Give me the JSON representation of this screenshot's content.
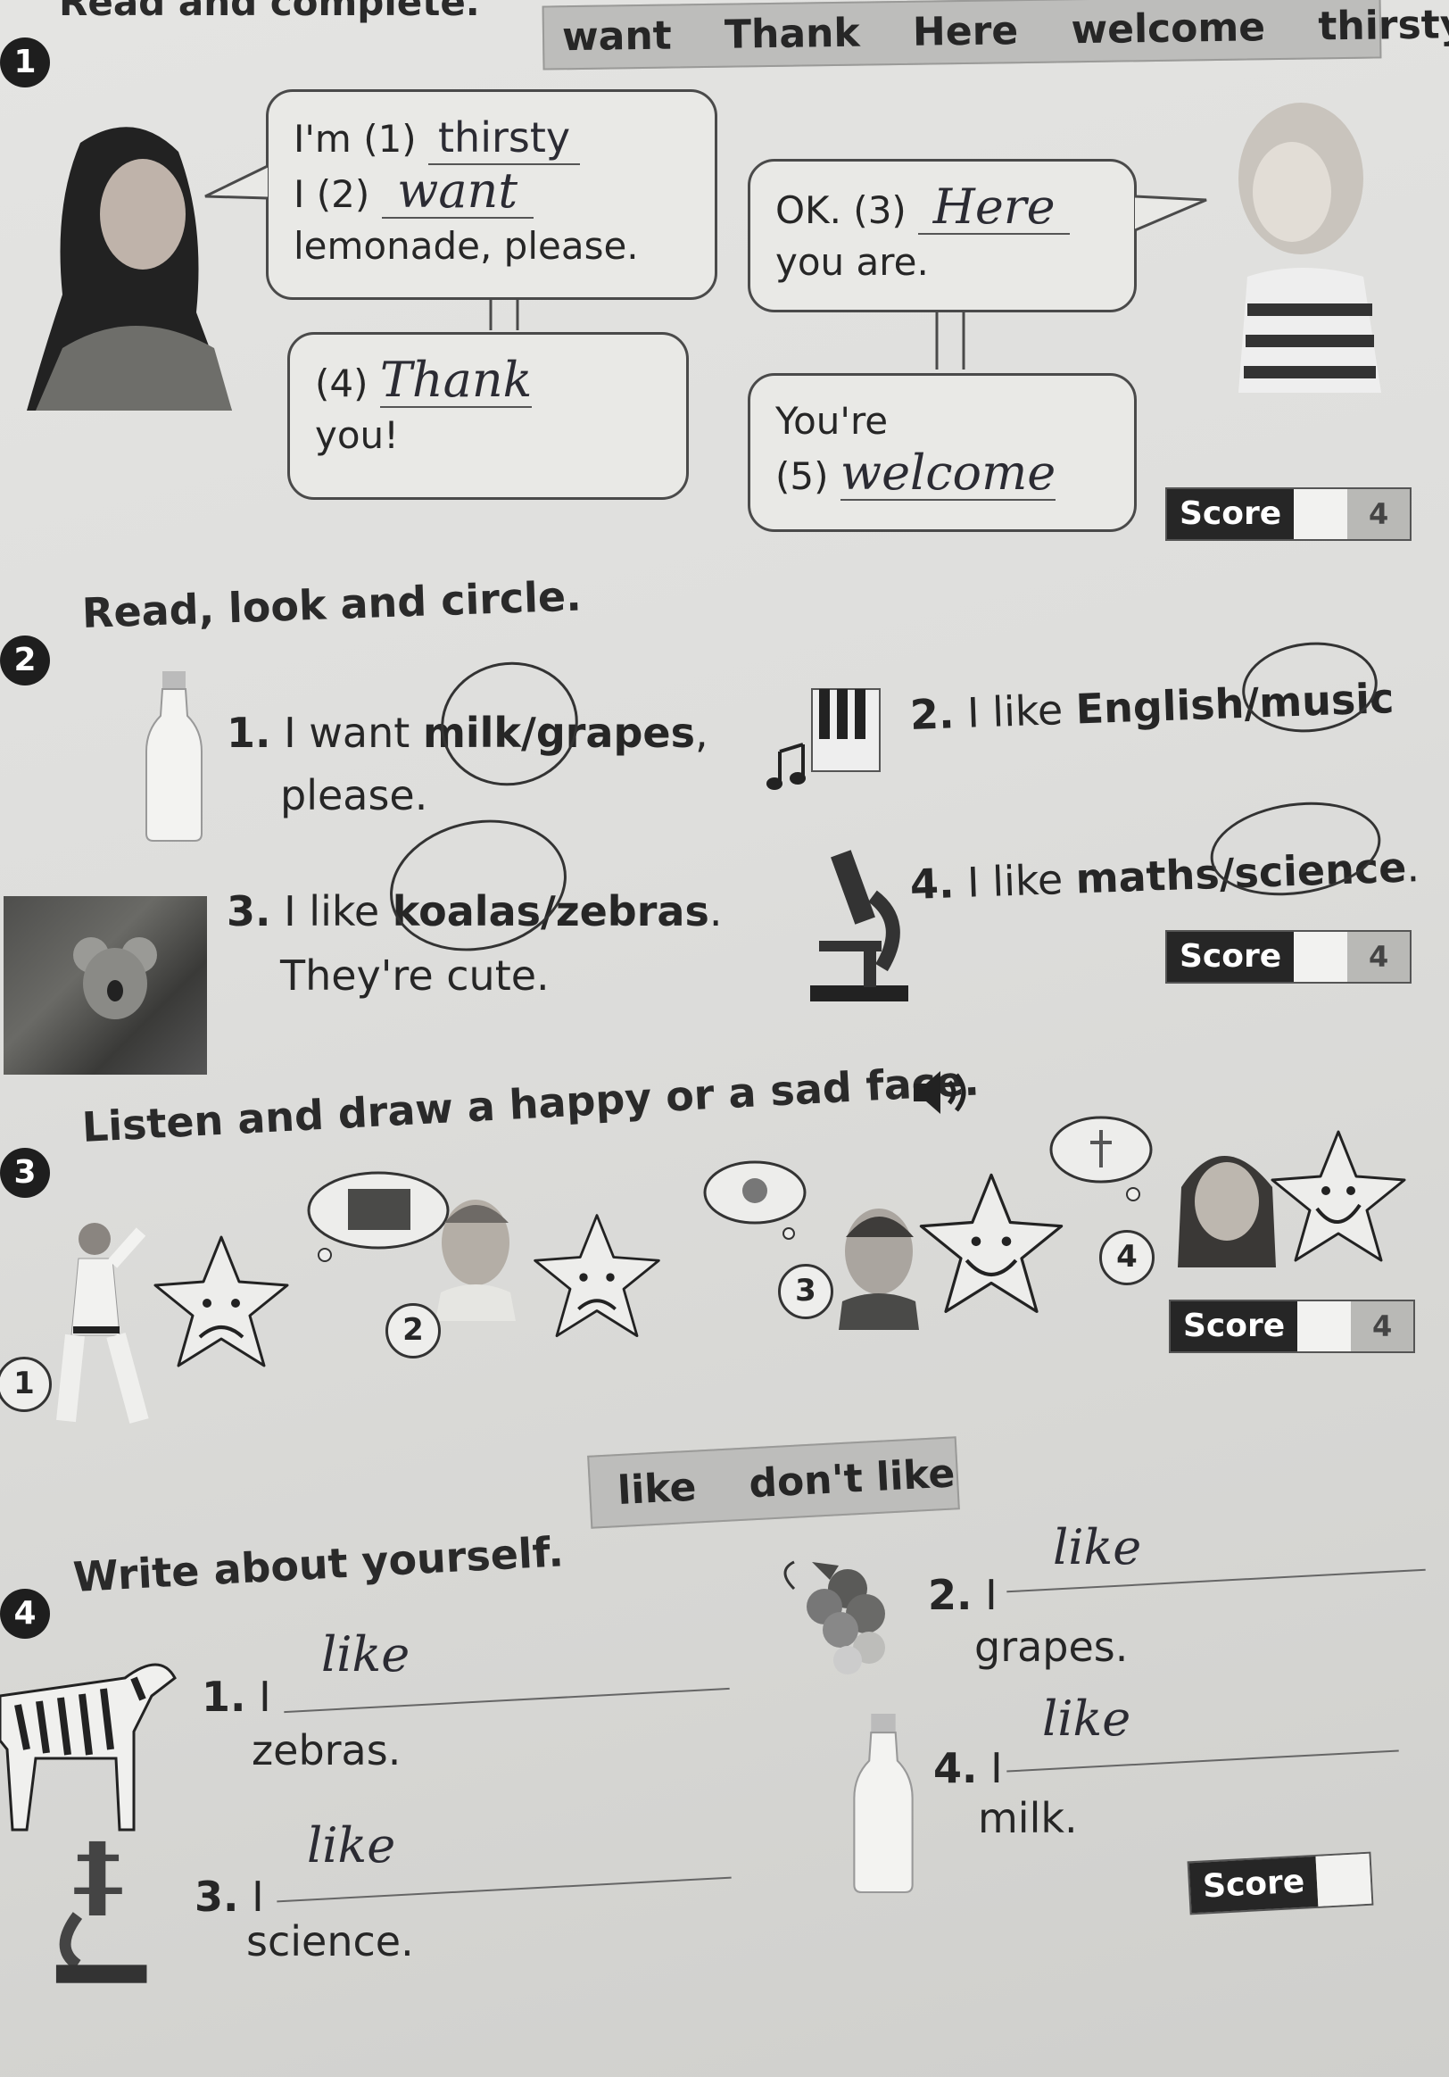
{
  "ex1": {
    "number": "1",
    "heading": "Read and complete.",
    "word_bank": [
      "want",
      "Thank",
      "Here",
      "welcome",
      "thirsty"
    ],
    "bubble1": {
      "line1_prefix": "I'm (1)",
      "answer1": "thirsty",
      "line2_prefix": "I (2)",
      "answer2": "want",
      "line3": "lemonade, please."
    },
    "bubble2": {
      "prefix": "OK. (3)",
      "answer": "Here",
      "line2": "you are."
    },
    "bubble3": {
      "prefix": "(4)",
      "answer": "Thank",
      "line2": "you!"
    },
    "bubble4": {
      "line1": "You're",
      "prefix": "(5)",
      "answer": "welcome"
    },
    "score": {
      "label": "Score",
      "max": "4"
    }
  },
  "ex2": {
    "number": "2",
    "heading": "Read, look and circle.",
    "item1": {
      "num": "1.",
      "pre": "I want",
      "opt_a": "milk",
      "slash": "/",
      "opt_b": "grapes",
      "post": ",",
      "line2": "please."
    },
    "item2": {
      "num": "2.",
      "pre": "I like",
      "opt_a": "English",
      "slash": "/",
      "opt_b": "music"
    },
    "item3": {
      "num": "3.",
      "pre": "I like",
      "opt_a": "koalas",
      "slash": "/",
      "opt_b": "zebras",
      "post": ".",
      "line2": "They're cute."
    },
    "item4": {
      "num": "4.",
      "pre": "I like",
      "opt_a": "maths",
      "slash": "/",
      "opt_b": "science",
      "post": "."
    },
    "score": {
      "label": "Score",
      "max": "4"
    }
  },
  "ex3": {
    "number": "3",
    "heading": "Listen and draw a happy or a sad face.",
    "labels": [
      "1",
      "2",
      "3",
      "4"
    ],
    "faces": [
      "sad",
      "sad",
      "happy",
      "happy"
    ],
    "score": {
      "label": "Score",
      "max": "4"
    }
  },
  "ex4": {
    "number": "4",
    "heading": "Write about yourself.",
    "word_bank": [
      "like",
      "don't like"
    ],
    "item1": {
      "num": "1.",
      "pre": "I",
      "answer": "like",
      "line2": "zebras."
    },
    "item2": {
      "num": "2.",
      "pre": "I",
      "answer": "like",
      "line2": "grapes."
    },
    "item3": {
      "num": "3.",
      "pre": "I",
      "answer": "like",
      "line2": "science."
    },
    "item4": {
      "num": "4.",
      "pre": "I",
      "answer": "like",
      "line2": "milk."
    },
    "score": {
      "label": "Score"
    }
  }
}
